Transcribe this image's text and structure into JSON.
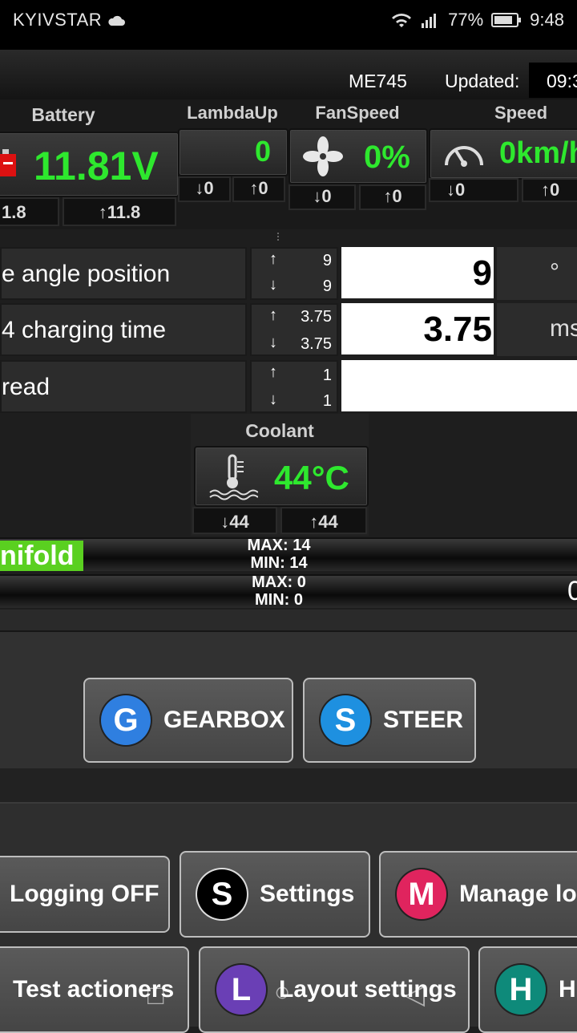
{
  "status_bar": {
    "carrier": "KYIVSTAR",
    "battery": "77%",
    "time": "9:48",
    "icons": [
      "cloud-icon",
      "wifi-icon",
      "signal-icon",
      "battery-icon"
    ]
  },
  "header": {
    "vehicle": "ME745",
    "updated_label": "Updated:",
    "updated_time": "09:3"
  },
  "gauges": {
    "battery": {
      "title": "Battery",
      "value": "11.81V",
      "min": "1.8",
      "max": "11.8",
      "icon": "battery-icon"
    },
    "lambda": {
      "title": "LambdaUp",
      "value": "0",
      "min": "0",
      "max": "0"
    },
    "fan": {
      "title": "FanSpeed",
      "value": "0%",
      "min": "0",
      "max": "0",
      "icon": "fan-icon"
    },
    "speed": {
      "title": "Speed",
      "value": "0km/h",
      "min": "0",
      "max": "0",
      "icon": "speedometer-icon"
    }
  },
  "params": [
    {
      "name": "e angle position",
      "max": "9",
      "min": "9",
      "value": "9",
      "unit": "°"
    },
    {
      "name": "4 charging time",
      "max": "3.75",
      "min": "3.75",
      "value": "3.75",
      "unit": "ms"
    },
    {
      "name": "read",
      "max": "1",
      "min": "1",
      "value": "",
      "unit": ""
    }
  ],
  "coolant": {
    "title": "Coolant",
    "value": "44°C",
    "min": "44",
    "max": "44",
    "icon": "thermometer-icon"
  },
  "bars": [
    {
      "label": "nifold",
      "max": "MAX: 14",
      "min": "MIN: 14",
      "right": ""
    },
    {
      "label": "",
      "max": "MAX: 0",
      "min": "MIN: 0",
      "right": "0"
    }
  ],
  "modules": [
    {
      "letter": "G",
      "label": "GEARBOX",
      "color": "#2f7fe0"
    },
    {
      "letter": "S",
      "label": "STEER",
      "color": "#1e90e0"
    }
  ],
  "menu_row1": [
    {
      "letter": "",
      "label": "Logging OFF",
      "color": ""
    },
    {
      "letter": "S",
      "label": "Settings",
      "color": "#000000"
    },
    {
      "letter": "M",
      "label": "Manage lo",
      "color": "#e0245e"
    }
  ],
  "menu_row2": [
    {
      "letter": "",
      "label": "Test actioners",
      "color": ""
    },
    {
      "letter": "L",
      "label": "Layout settings",
      "color": "#6a3fb5"
    },
    {
      "letter": "H",
      "label": "H",
      "color": "#0e8a7a"
    }
  ],
  "arrows": {
    "up": "↑",
    "down": "↓"
  },
  "nav": {
    "recent": "□",
    "home": "○",
    "back": "◁"
  }
}
